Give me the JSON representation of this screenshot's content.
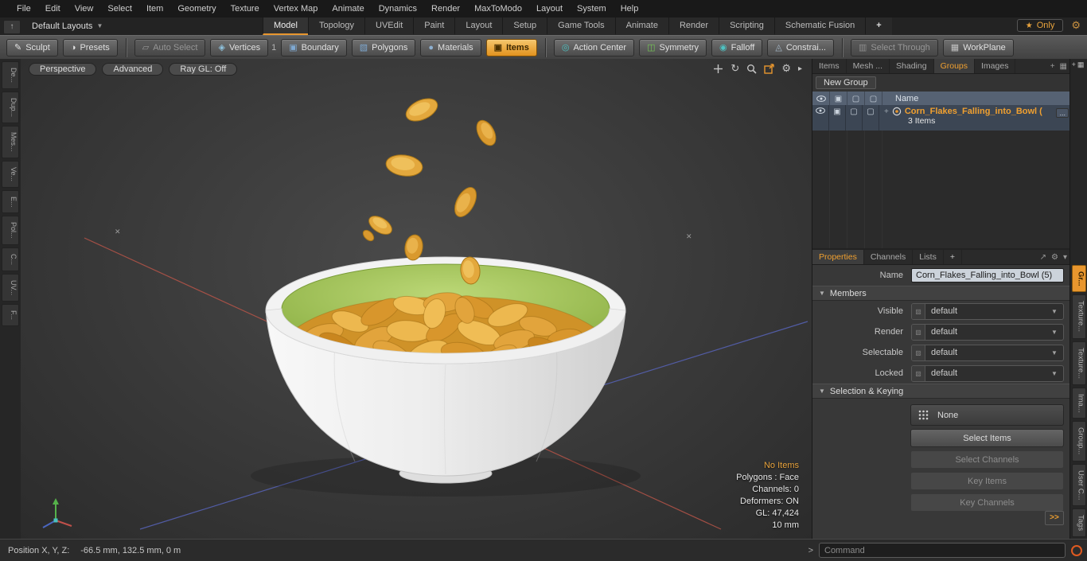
{
  "colors": {
    "accent_orange": "#e8962e",
    "selection_blue": "#566273",
    "flake_gold": "#e2a43c",
    "bowl_green": "#9cc153"
  },
  "menu": {
    "items": [
      "File",
      "Edit",
      "View",
      "Select",
      "Item",
      "Geometry",
      "Texture",
      "Vertex Map",
      "Animate",
      "Dynamics",
      "Render",
      "MaxToModo",
      "Layout",
      "System",
      "Help"
    ]
  },
  "layout_bar": {
    "selector": "Default Layouts",
    "tabs": [
      "Model",
      "Topology",
      "UVEdit",
      "Paint",
      "Layout",
      "Setup",
      "Game Tools",
      "Animate",
      "Render",
      "Scripting",
      "Schematic Fusion"
    ],
    "add": "+",
    "only": "Only"
  },
  "toolbar": {
    "sculpt": "Sculpt",
    "presets": "Presets",
    "auto_select": "Auto Select",
    "vertices": "Vertices",
    "vertices_count": "1",
    "boundary": "Boundary",
    "polygons": "Polygons",
    "materials": "Materials",
    "items": "Items",
    "action_center": "Action Center",
    "symmetry": "Symmetry",
    "falloff": "Falloff",
    "constraints": "Constrai...",
    "select_through": "Select Through",
    "workplane": "WorkPlane"
  },
  "viewport": {
    "modes": [
      "Perspective",
      "Advanced",
      "Ray GL: Off"
    ],
    "info": [
      "No Items",
      "Polygons : Face",
      "Channels: 0",
      "Deformers: ON",
      "GL: 47,424",
      "10 mm"
    ]
  },
  "groups_panel": {
    "tabs": [
      "Items",
      "Mesh ...",
      "Shading",
      "Groups",
      "Images"
    ],
    "add": "+",
    "new_group": "New Group",
    "name_header": "Name",
    "item_name": "Corn_Flakes_Falling_into_Bowl (",
    "item_count": "3 Items",
    "more": "..."
  },
  "properties_panel": {
    "tabs": [
      "Properties",
      "Channels",
      "Lists"
    ],
    "add": "+",
    "name_label": "Name",
    "name_value": "Corn_Flakes_Falling_into_Bowl (5)",
    "members_section": "Members",
    "selection_section": "Selection & Keying",
    "fields": [
      {
        "label": "Visible",
        "value": "default"
      },
      {
        "label": "Render",
        "value": "default"
      },
      {
        "label": "Selectable",
        "value": "default"
      },
      {
        "label": "Locked",
        "value": "default"
      }
    ],
    "none_button": "None",
    "select_items": "Select Items",
    "select_channels": "Select Channels",
    "key_items": "Key Items",
    "key_channels": "Key Channels",
    "expand": ">>"
  },
  "left_strip": {
    "tabs": [
      "De...",
      "Dup...",
      "Mes...",
      "Ve...",
      "E...",
      "Pol...",
      "C...",
      "UV...",
      "F..."
    ]
  },
  "right_strip": {
    "tabs": [
      "Gr...",
      "Texture...",
      "Texture...",
      "Ima...",
      "Group...",
      "User C...",
      "Tags"
    ]
  },
  "status_bar": {
    "position_label": "Position X, Y, Z:",
    "position_value": "-66.5 mm, 132.5 mm, 0 m",
    "prompt": ">",
    "command_placeholder": "Command"
  }
}
